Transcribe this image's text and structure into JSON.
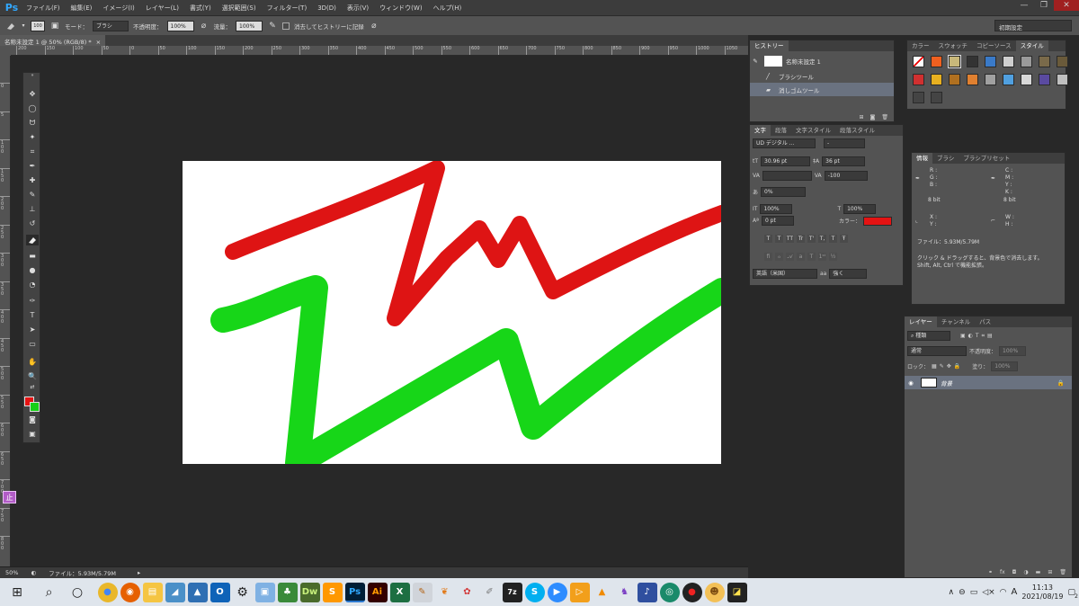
{
  "app": {
    "logo": "Ps"
  },
  "menu": [
    "ファイル(F)",
    "編集(E)",
    "イメージ(I)",
    "レイヤー(L)",
    "書式(Y)",
    "選択範囲(S)",
    "フィルター(T)",
    "3D(D)",
    "表示(V)",
    "ウィンドウ(W)",
    "ヘルプ(H)"
  ],
  "window_controls": {
    "minimize": "—",
    "restore": "❐",
    "close": "✕"
  },
  "options": {
    "brush_size": "100",
    "mode_label": "モード：",
    "mode_value": "ブラシ",
    "opacity_label": "不透明度：",
    "opacity_value": "100%",
    "flow_label": "流量：",
    "flow_value": "100%",
    "erase_history_label": "消去してヒストリーに記録",
    "workspace": "初期設定"
  },
  "document": {
    "tab_title": "名称未設定 1 @ 50% (RGB/8) *",
    "tab_close": "×"
  },
  "ruler_h": [
    "200",
    "150",
    "100",
    "50",
    "0",
    "50",
    "100",
    "150",
    "200",
    "250",
    "300",
    "350",
    "400",
    "450",
    "500",
    "550",
    "600",
    "650",
    "700",
    "750",
    "800",
    "850",
    "900",
    "950",
    "1000",
    "1050"
  ],
  "ruler_v": [
    "0",
    "5",
    "1 0 0",
    "1 5 0",
    "2 0 0",
    "2 5 0",
    "3 0 0",
    "3 5 0",
    "4 0 0",
    "4 5 0",
    "5 0 0",
    "5 5 0",
    "6 0 0",
    "6 5 0",
    "7 0 0",
    "7 5 0",
    "8 0 0"
  ],
  "status": {
    "zoom": "50%",
    "file": "ファイル：5.93M/5.79M"
  },
  "history": {
    "tab": "ヒストリー",
    "snapshot": "名称未設定 1",
    "items": [
      "ブラシツール",
      "消しゴムツール"
    ]
  },
  "character": {
    "tabs": [
      "文字",
      "段落",
      "文字スタイル",
      "段落スタイル"
    ],
    "font_family": "UD デジタル ...",
    "font_style": "-",
    "size": "30.96 pt",
    "leading": "36 pt",
    "tracking": "-100",
    "scale_pct": "0%",
    "v_scale": "100%",
    "h_scale": "100%",
    "baseline": "0 pt",
    "color_label": "カラー：",
    "language": "英語（米国）",
    "aa": "強く",
    "typo_buttons": [
      "T",
      "T",
      "TT",
      "Tr",
      "T'",
      "T,",
      "T",
      "Ŧ"
    ]
  },
  "color_panel": {
    "tabs": [
      "カラー",
      "スウォッチ",
      "コピーソース",
      "スタイル"
    ]
  },
  "info": {
    "tabs": [
      "情報",
      "ブラシ",
      "ブラシプリセット"
    ],
    "rgb": [
      "R :",
      "G :",
      "B :"
    ],
    "cmyk": [
      "C :",
      "M :",
      "Y :",
      "K :"
    ],
    "bits": "8 bit",
    "xy": [
      "X :",
      "Y :"
    ],
    "wh": [
      "W :",
      "H :"
    ],
    "file": "ファイル：5.93M/5.79M",
    "help1": "クリック & ドラッグすると、背景色で消去します。",
    "help2": "Shift, Alt, Ctrl で機能拡張。"
  },
  "layers": {
    "tabs": [
      "レイヤー",
      "チャンネル",
      "パス"
    ],
    "filter": "種類",
    "blend": "通常",
    "opacity_label": "不透明度：",
    "opacity_value": "100%",
    "lock_label": "ロック：",
    "fill_label": "塗り：",
    "fill_value": "100%",
    "layer_name": "背景"
  },
  "ime": "止",
  "taskbar": {
    "apps": [
      "Dw",
      "Ps",
      "Ai",
      "X",
      "7z",
      "S"
    ],
    "time": "11:13",
    "date": "2021/08/19",
    "ime_mode": "A",
    "notifications": "2"
  },
  "colors": {
    "foreground": "#e51313",
    "background": "#17d017",
    "red_stroke": "#de1414",
    "green_stroke": "#17d618"
  }
}
